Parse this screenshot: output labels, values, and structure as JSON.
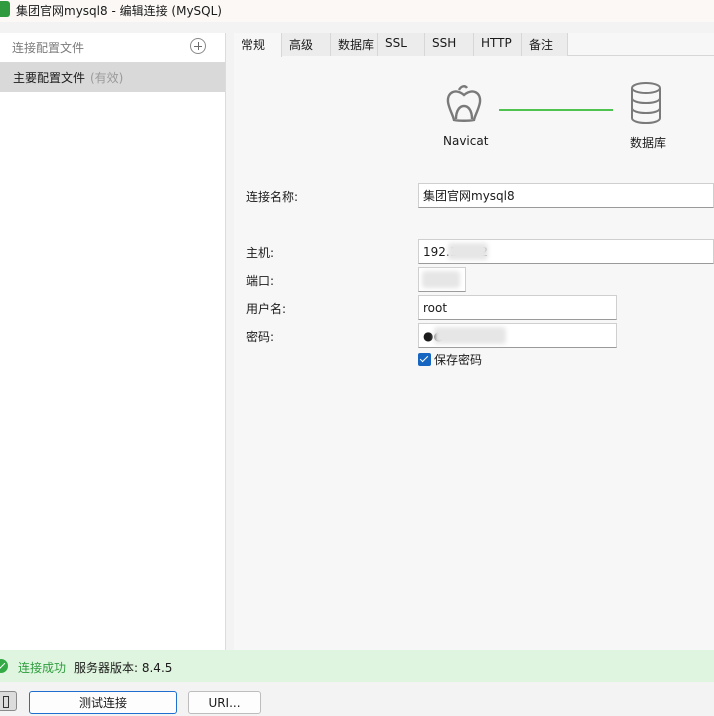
{
  "window": {
    "title": "集团官网mysql8 - 编辑连接 (MySQL)"
  },
  "sidebar": {
    "header_label": "连接配置文件",
    "items": [
      {
        "label": "主要配置文件",
        "tag": "(有效)"
      }
    ]
  },
  "tabs": [
    {
      "label": "常规",
      "active": true
    },
    {
      "label": "高级"
    },
    {
      "label": "数据库"
    },
    {
      "label": "SSL"
    },
    {
      "label": "SSH"
    },
    {
      "label": "HTTP"
    },
    {
      "label": "备注"
    }
  ],
  "diagram": {
    "left_label": "Navicat",
    "right_label": "数据库",
    "line_color": "#4fc34f"
  },
  "form": {
    "connection_name": {
      "label": "连接名称:",
      "value": "集团官网mysql8"
    },
    "host": {
      "label": "主机:",
      "value": "192.1      2"
    },
    "port": {
      "label": "端口:",
      "value": ""
    },
    "username": {
      "label": "用户名:",
      "value": "root"
    },
    "password": {
      "label": "密码:",
      "value": "●●"
    },
    "save_password": {
      "label": "保存密码",
      "checked": true
    }
  },
  "status": {
    "message": "连接成功",
    "server_version": "服务器版本: 8.4.5",
    "color": "#2e9d3d"
  },
  "buttons": {
    "test_connection": "测试连接",
    "uri": "URI..."
  },
  "colors": {
    "accent": "#1665c1",
    "status_bg": "#dff5df"
  }
}
